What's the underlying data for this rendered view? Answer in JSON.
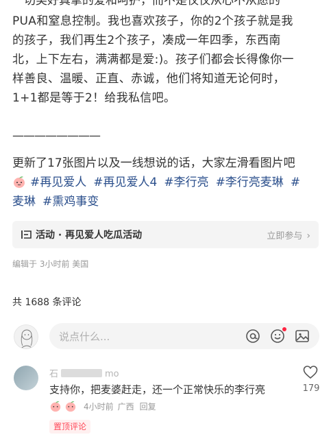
{
  "post": {
    "cut_line": "一切美好真挚的爱和呵护，而不是仅仅从心不从愿的",
    "lines": [
      "PUA和窒息控制。我也喜欢孩子，你的2个孩子就是我",
      "的孩子，我们再生2个孩子，凑成一年四季，东西南",
      "北，上下左右，满满都是爱:)。孩子们都会长得像你一",
      "样善良、温暖、正直、赤诚，他们将知道无论何时，",
      "1+1都是等于2！给我私信吧。"
    ],
    "divider": "————————",
    "update_text": "更新了17张图片以及一线想说的话，大家左滑看图片吧",
    "tags_line1": [
      "#再见爱人",
      "#再见爱人4",
      "#李行亮",
      "#李行亮麦琳",
      "#"
    ],
    "tags_line2": [
      "麦琳",
      "#熏鸡事变"
    ]
  },
  "activity": {
    "label": "活动 · 再见爱人吃瓜活动",
    "cta": "立即参与"
  },
  "meta": {
    "edited": "编辑于 3小时前 美国"
  },
  "comments_header": {
    "count_text": "共 1688 条评论"
  },
  "comment_input": {
    "placeholder": "说点什么..."
  },
  "comment": {
    "name_prefix": "石",
    "name_suffix": "mo",
    "text": "支持你，把麦婆赶走，还一个正常快乐的李行亮",
    "time": "4小时前",
    "location": "广西",
    "reply": "回复",
    "likes": "179",
    "badge": "置顶评论"
  },
  "colors": {
    "tag": "#2b4f8c",
    "accent": "#ff2442",
    "muted": "#999999"
  }
}
